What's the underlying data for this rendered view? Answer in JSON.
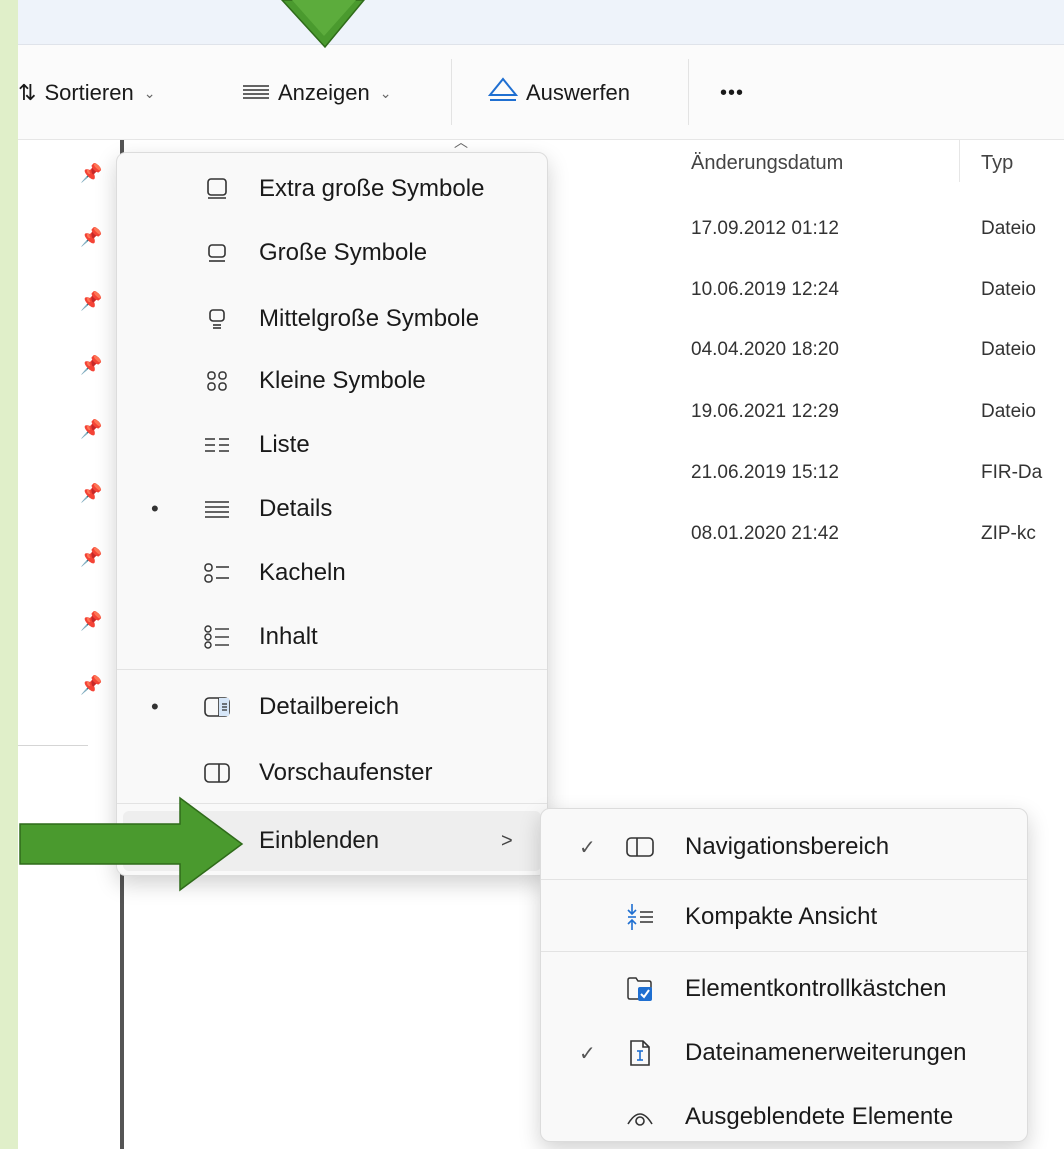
{
  "toolbar": {
    "sort_label": "Sortieren",
    "view_label": "Anzeigen",
    "eject_label": "Auswerfen",
    "more_label": "•••"
  },
  "columns": {
    "date": "Änderungsdatum",
    "type": "Typ"
  },
  "rows": [
    {
      "date": "17.09.2012 01:12",
      "type": "Dateio"
    },
    {
      "date": "10.06.2019 12:24",
      "type": "Dateio"
    },
    {
      "date": "04.04.2020 18:20",
      "type": "Dateio"
    },
    {
      "date": "19.06.2021 12:29",
      "type": "Dateio"
    },
    {
      "date": "21.06.2019 15:12",
      "type": "FIR-Da"
    },
    {
      "date": "08.01.2020 21:42",
      "type": "ZIP-kc"
    }
  ],
  "view_menu": {
    "items": [
      {
        "label": "Extra große Symbole",
        "icon": "monitor-large-icon",
        "selected": false
      },
      {
        "label": "Große Symbole",
        "icon": "monitor-icon",
        "selected": false
      },
      {
        "label": "Mittelgroße Symbole",
        "icon": "monitor-medium-icon",
        "selected": false
      },
      {
        "label": "Kleine Symbole",
        "icon": "small-icons-grid-icon",
        "selected": false
      },
      {
        "label": "Liste",
        "icon": "list-icon",
        "selected": false
      },
      {
        "label": "Details",
        "icon": "details-icon",
        "selected": true
      },
      {
        "label": "Kacheln",
        "icon": "tiles-icon",
        "selected": false
      },
      {
        "label": "Inhalt",
        "icon": "content-icon",
        "selected": false
      },
      {
        "label": "Detailbereich",
        "icon": "details-pane-icon",
        "selected": true
      },
      {
        "label": "Vorschaufenster",
        "icon": "preview-pane-icon",
        "selected": false
      },
      {
        "label": "Einblenden",
        "icon": "",
        "selected": false,
        "arrow": ">"
      }
    ]
  },
  "show_submenu": {
    "items": [
      {
        "label": "Navigationsbereich",
        "icon": "navigation-pane-icon",
        "checked": true
      },
      {
        "label": "Kompakte Ansicht",
        "icon": "compact-view-icon",
        "checked": false
      },
      {
        "label": "Elementkontrollkästchen",
        "icon": "item-checkbox-icon",
        "checked": false
      },
      {
        "label": "Dateinamenerweiterungen",
        "icon": "file-extension-icon",
        "checked": true
      },
      {
        "label": "Ausgeblendete Elemente",
        "icon": "hidden-items-icon",
        "checked": false
      }
    ],
    "check_mark": "✓"
  },
  "colors": {
    "annotation_arrow": "#4a9a2e",
    "background": "#e0efc9",
    "accent_blue": "#1f6fd1"
  }
}
